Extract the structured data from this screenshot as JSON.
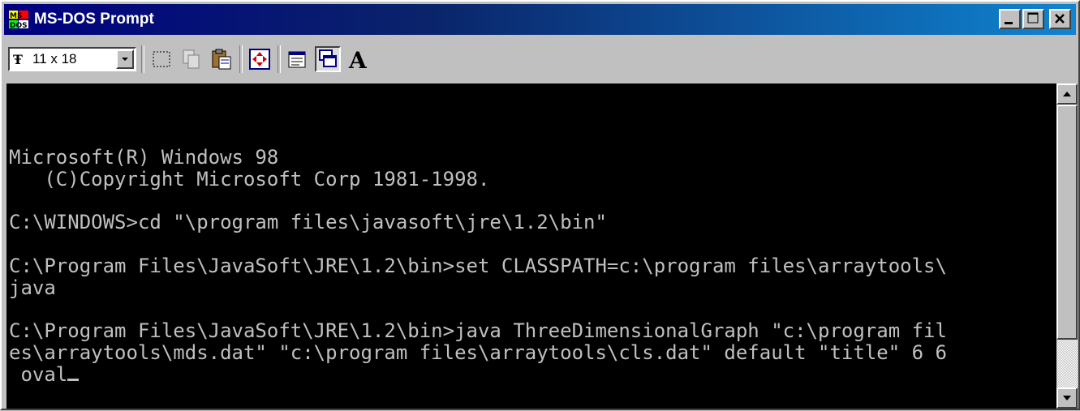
{
  "window": {
    "title": "MS-DOS Prompt"
  },
  "toolbar": {
    "font_size": "11 x 18",
    "buttons": [
      "mark-icon",
      "copy-icon",
      "paste-icon",
      "fullscreen-icon",
      "properties-icon",
      "background-icon",
      "font-icon"
    ]
  },
  "console": {
    "lines": [
      "",
      "Microsoft(R) Windows 98",
      "   (C)Copyright Microsoft Corp 1981-1998.",
      "",
      "C:\\WINDOWS>cd \"\\program files\\javasoft\\jre\\1.2\\bin\"",
      "",
      "C:\\Program Files\\JavaSoft\\JRE\\1.2\\bin>set CLASSPATH=c:\\program files\\arraytools\\",
      "java",
      "",
      "C:\\Program Files\\JavaSoft\\JRE\\1.2\\bin>java ThreeDimensionalGraph \"c:\\program fil",
      "es\\arraytools\\mds.dat\" \"c:\\program files\\arraytools\\cls.dat\" default \"title\" 6 6",
      " oval"
    ]
  },
  "colors": {
    "title_start": "#000080",
    "title_end": "#1084d0",
    "console_bg": "#000000",
    "console_fg": "#c0c0c0",
    "face": "#c0c0c0"
  }
}
